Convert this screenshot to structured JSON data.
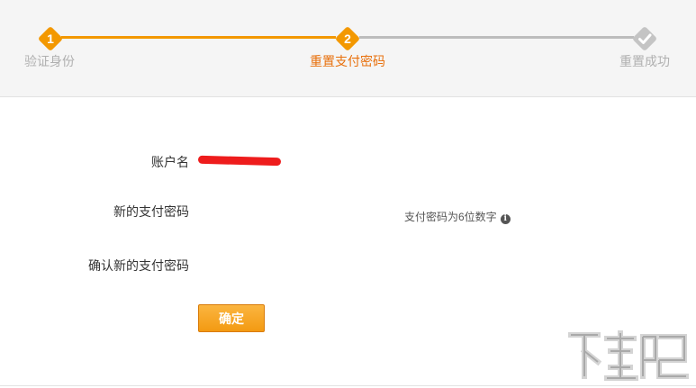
{
  "steps": [
    {
      "number": "1",
      "label": "验证身份",
      "state": "done"
    },
    {
      "number": "2",
      "label": "重置支付密码",
      "state": "current"
    },
    {
      "number": "",
      "label": "重置成功",
      "state": "todo"
    }
  ],
  "form": {
    "account_label": "账户名",
    "account_value": "",
    "new_password_label": "新的支付密码",
    "confirm_password_label": "确认新的支付密码",
    "hint": "支付密码为6位数字",
    "info_icon": "info-icon",
    "submit_label": "确定"
  },
  "colors": {
    "accent": "#f39800",
    "inactive": "#bdbdbd",
    "current_label": "#e8700c",
    "redaction": "#ee1c1c"
  }
}
